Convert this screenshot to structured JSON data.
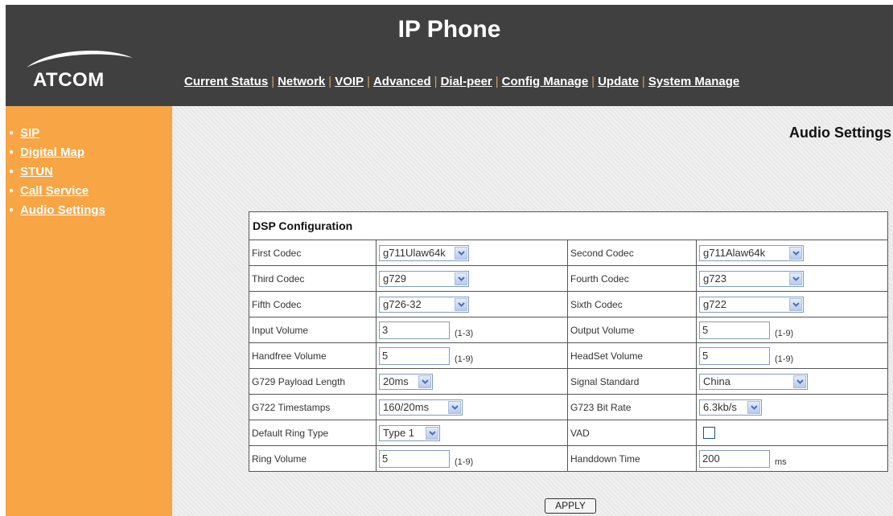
{
  "header": {
    "title": "IP Phone",
    "logo": "ATCOM",
    "nav": [
      "Current Status",
      "Network",
      "VOIP",
      "Advanced",
      "Dial-peer",
      "Config Manage",
      "Update",
      "System Manage"
    ]
  },
  "sidebar": {
    "items": [
      "SIP",
      "Digital Map",
      "STUN",
      "Call Service",
      "Audio Settings"
    ]
  },
  "page": {
    "heading": "Audio Settings",
    "section": "DSP Configuration",
    "apply_label": "APPLY"
  },
  "fields": {
    "first_codec": {
      "label": "First Codec",
      "value": "g711Ulaw64k"
    },
    "second_codec": {
      "label": "Second Codec",
      "value": "g711Alaw64k"
    },
    "third_codec": {
      "label": "Third Codec",
      "value": "g729"
    },
    "fourth_codec": {
      "label": "Fourth Codec",
      "value": "g723"
    },
    "fifth_codec": {
      "label": "Fifth Codec",
      "value": "g726-32"
    },
    "sixth_codec": {
      "label": "Sixth Codec",
      "value": "g722"
    },
    "input_volume": {
      "label": "Input Volume",
      "value": "3",
      "hint": "(1-3)"
    },
    "output_volume": {
      "label": "Output Volume",
      "value": "5",
      "hint": "(1-9)"
    },
    "handfree_volume": {
      "label": "Handfree Volume",
      "value": "5",
      "hint": "(1-9)"
    },
    "headset_volume": {
      "label": "HeadSet Volume",
      "value": "5",
      "hint": "(1-9)"
    },
    "g729_payload": {
      "label": "G729 Payload Length",
      "value": "20ms"
    },
    "signal_standard": {
      "label": "Signal Standard",
      "value": "China"
    },
    "g722_timestamps": {
      "label": "G722 Timestamps",
      "value": "160/20ms"
    },
    "g723_bit_rate": {
      "label": "G723 Bit Rate",
      "value": "6.3kb/s"
    },
    "default_ring_type": {
      "label": "Default Ring Type",
      "value": "Type 1"
    },
    "vad": {
      "label": "VAD",
      "checked": false
    },
    "ring_volume": {
      "label": "Ring Volume",
      "value": "5",
      "hint": "(1-9)"
    },
    "handdown_time": {
      "label": "Handdown Time",
      "value": "200",
      "unit": "ms"
    }
  },
  "colors": {
    "header_bg": "#404040",
    "sidebar_bg": "#f7a545",
    "select_arrow": "#4a6fb5"
  },
  "icons": {
    "dropdown": "chevron-down-icon",
    "logo_swoosh": "logo-swoosh-icon"
  }
}
